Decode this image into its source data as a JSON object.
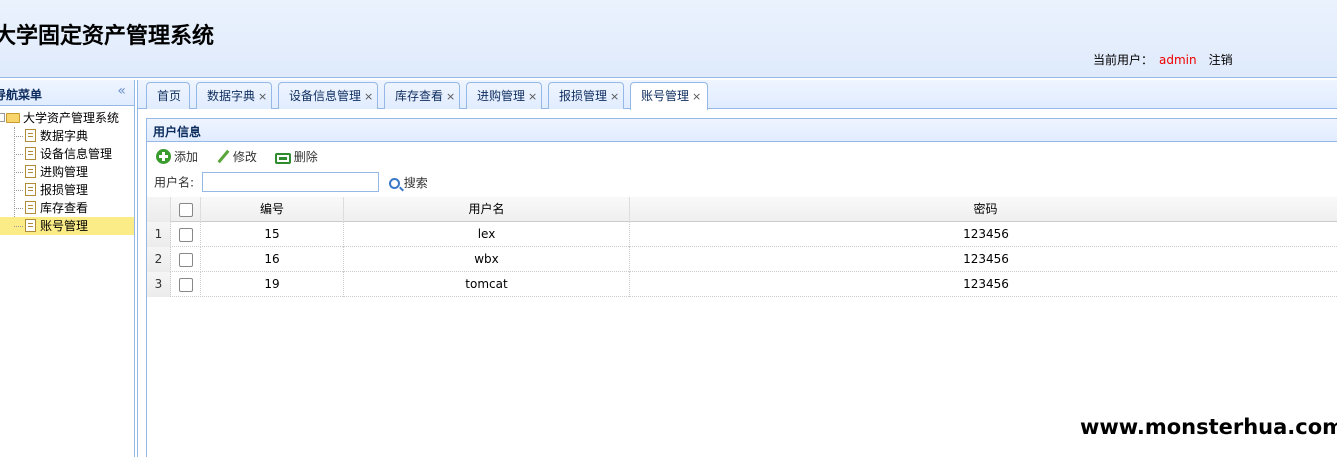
{
  "header": {
    "title": "大学固定资产管理系统",
    "current_user_label": "当前用户：",
    "current_user": "admin",
    "logout_label": "注销"
  },
  "sidebar": {
    "title": "导航菜单",
    "collapse_icon": "double-chevron-left-icon",
    "root": "大学资产管理系统",
    "items": [
      {
        "label": "数据字典"
      },
      {
        "label": "设备信息管理"
      },
      {
        "label": "进购管理"
      },
      {
        "label": "报损管理"
      },
      {
        "label": "库存查看"
      },
      {
        "label": "账号管理",
        "selected": true
      }
    ]
  },
  "tabs": [
    {
      "label": "首页",
      "closable": false
    },
    {
      "label": "数据字典",
      "closable": true
    },
    {
      "label": "设备信息管理",
      "closable": true
    },
    {
      "label": "库存查看",
      "closable": true
    },
    {
      "label": "进购管理",
      "closable": true
    },
    {
      "label": "报损管理",
      "closable": true
    },
    {
      "label": "账号管理",
      "closable": true,
      "active": true
    }
  ],
  "tab_close": "×",
  "panel": {
    "title": "用户信息",
    "toolbar": {
      "add_label": "添加",
      "edit_label": "修改",
      "delete_label": "删除"
    },
    "search": {
      "label": "用户名:",
      "value": "",
      "button_label": "搜索"
    }
  },
  "grid": {
    "columns": [
      "编号",
      "用户名",
      "密码"
    ],
    "rows": [
      {
        "num": "1",
        "id": "15",
        "username": "lex",
        "password": "123456"
      },
      {
        "num": "2",
        "id": "16",
        "username": "wbx",
        "password": "123456"
      },
      {
        "num": "3",
        "id": "19",
        "username": "tomcat",
        "password": "123456"
      }
    ]
  },
  "watermark": "www.monsterhua.com",
  "colors": {
    "header_bg": "#e3edfc",
    "border": "#95b8e7",
    "username_red": "#e00000",
    "selected_row": "#fbec88"
  }
}
